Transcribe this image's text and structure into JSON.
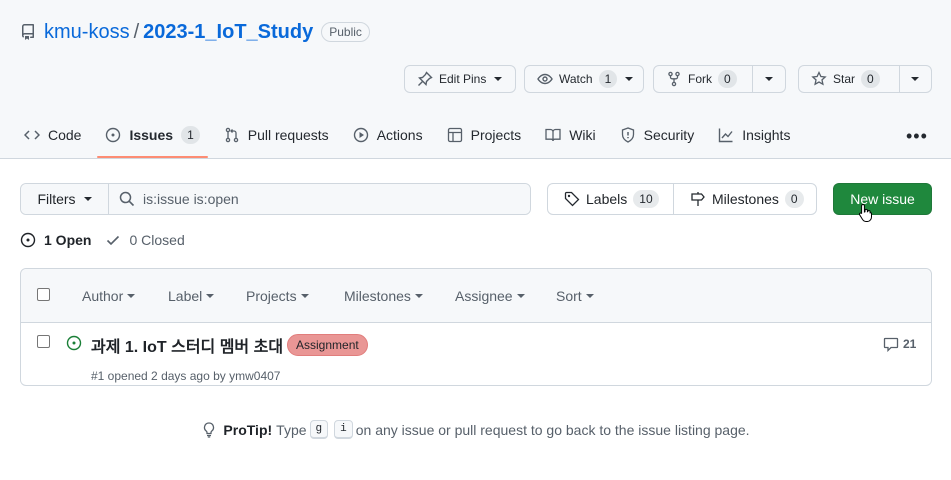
{
  "repo": {
    "owner": "kmu-koss",
    "separator": "/",
    "name": "2023-1_IoT_Study",
    "visibility": "Public"
  },
  "actions": {
    "edit_pins": "Edit Pins",
    "watch": {
      "label": "Watch",
      "count": "1"
    },
    "fork": {
      "label": "Fork",
      "count": "0"
    },
    "star": {
      "label": "Star",
      "count": "0"
    }
  },
  "tabs": [
    {
      "label": "Code",
      "icon": "code-icon"
    },
    {
      "label": "Issues",
      "icon": "issue-opened-icon",
      "count": "1",
      "active": true
    },
    {
      "label": "Pull requests",
      "icon": "git-pull-request-icon"
    },
    {
      "label": "Actions",
      "icon": "play-icon"
    },
    {
      "label": "Projects",
      "icon": "table-icon"
    },
    {
      "label": "Wiki",
      "icon": "book-icon"
    },
    {
      "label": "Security",
      "icon": "shield-icon"
    },
    {
      "label": "Insights",
      "icon": "graph-icon"
    }
  ],
  "filters": {
    "button": "Filters",
    "query": "is:issue is:open"
  },
  "labels": {
    "label": "Labels",
    "count": "10"
  },
  "milestones": {
    "label": "Milestones",
    "count": "0"
  },
  "new_issue": "New issue",
  "states": {
    "open": "1 Open",
    "closed": "0 Closed"
  },
  "list_header": {
    "author": "Author",
    "label": "Label",
    "projects": "Projects",
    "milestones": "Milestones",
    "assignee": "Assignee",
    "sort": "Sort"
  },
  "issues": [
    {
      "title": "과제 1. IoT 스터디 멤버 초대",
      "label": "Assignment",
      "label_color": "#e99695",
      "meta": "#1 opened 2 days ago by ymw0407",
      "comments": "21"
    }
  ],
  "protip": {
    "lead": "ProTip!",
    "before": "Type",
    "key1": "g",
    "key2": "i",
    "after": "on any issue or pull request to go back to the issue listing page."
  },
  "colors": {
    "link": "#0969da",
    "primary_button": "#1f883d",
    "tab_underline": "#fd8c73",
    "open_icon": "#1a7f37"
  }
}
